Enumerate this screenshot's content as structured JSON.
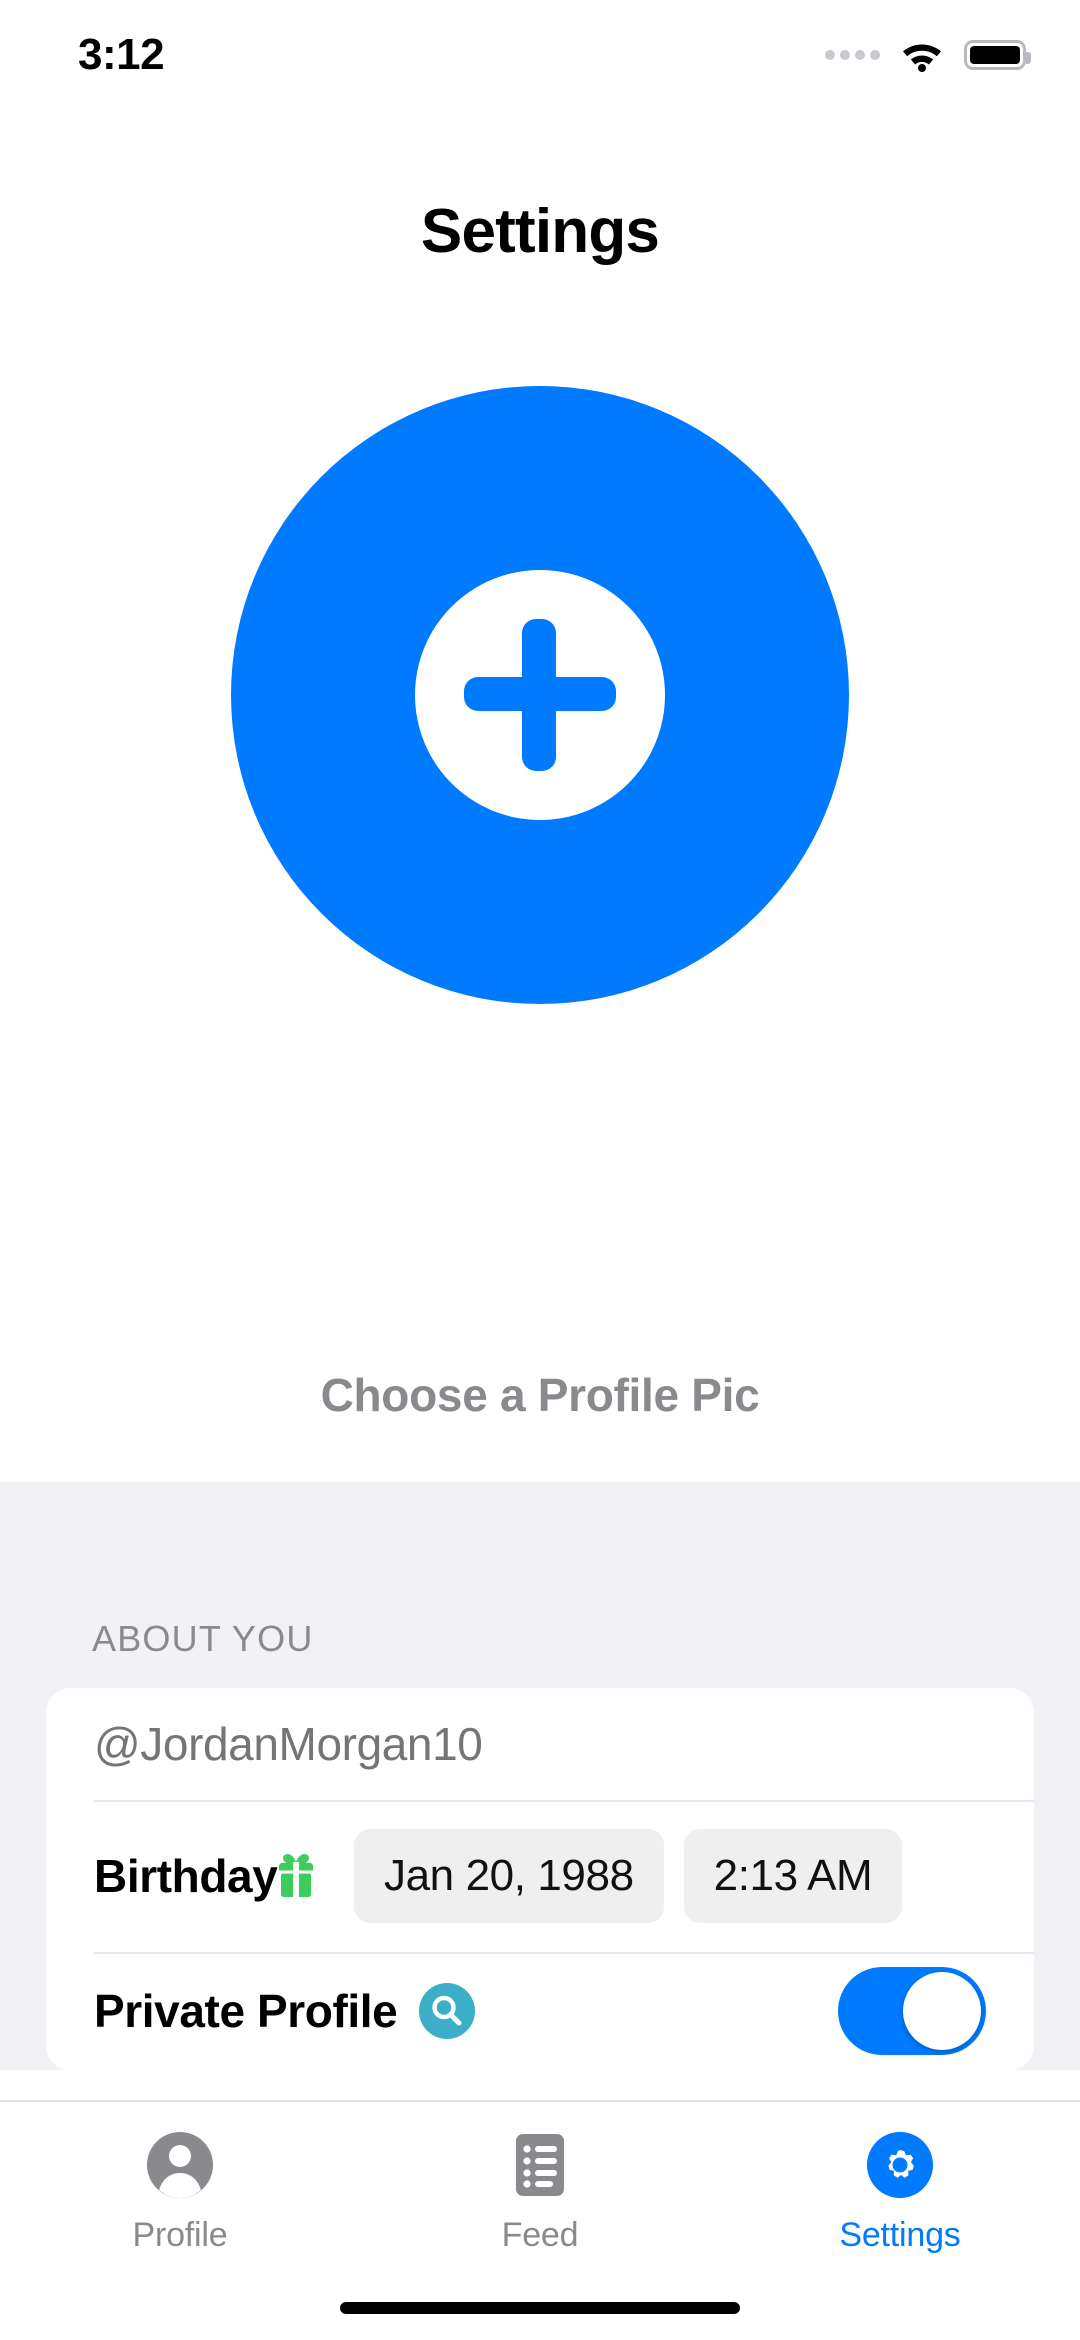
{
  "status_bar": {
    "time": "3:12",
    "signal_icon": "signal-dots-icon",
    "wifi_icon": "wifi-icon",
    "battery_icon": "battery-full-icon"
  },
  "header": {
    "title": "Settings"
  },
  "profile": {
    "avatar_button_name": "choose-profile-pic-button",
    "plus_icon": "plus-icon",
    "caption": "Choose a Profile Pic",
    "accent_color": "#007AFF"
  },
  "about_section": {
    "header": "ABOUT YOU",
    "username": {
      "value": "",
      "placeholder": "@JordanMorgan10"
    },
    "birthday": {
      "label": "Birthday",
      "icon": "gift-icon",
      "icon_color": "#3ECC5F",
      "date_value": "Jan 20, 1988",
      "time_value": "2:13 AM"
    },
    "private_profile": {
      "label": "Private Profile",
      "icon": "magnifying-glass-icon",
      "icon_color": "#3BAFC8",
      "toggle_on": true,
      "toggle_color": "#007AFF"
    }
  },
  "tab_bar": {
    "items": [
      {
        "label": "Profile",
        "icon": "person-icon",
        "active": false
      },
      {
        "label": "Feed",
        "icon": "list-icon",
        "active": false
      },
      {
        "label": "Settings",
        "icon": "gear-icon",
        "active": true
      }
    ],
    "active_color": "#007AFF",
    "inactive_color": "#8A8A8E"
  }
}
